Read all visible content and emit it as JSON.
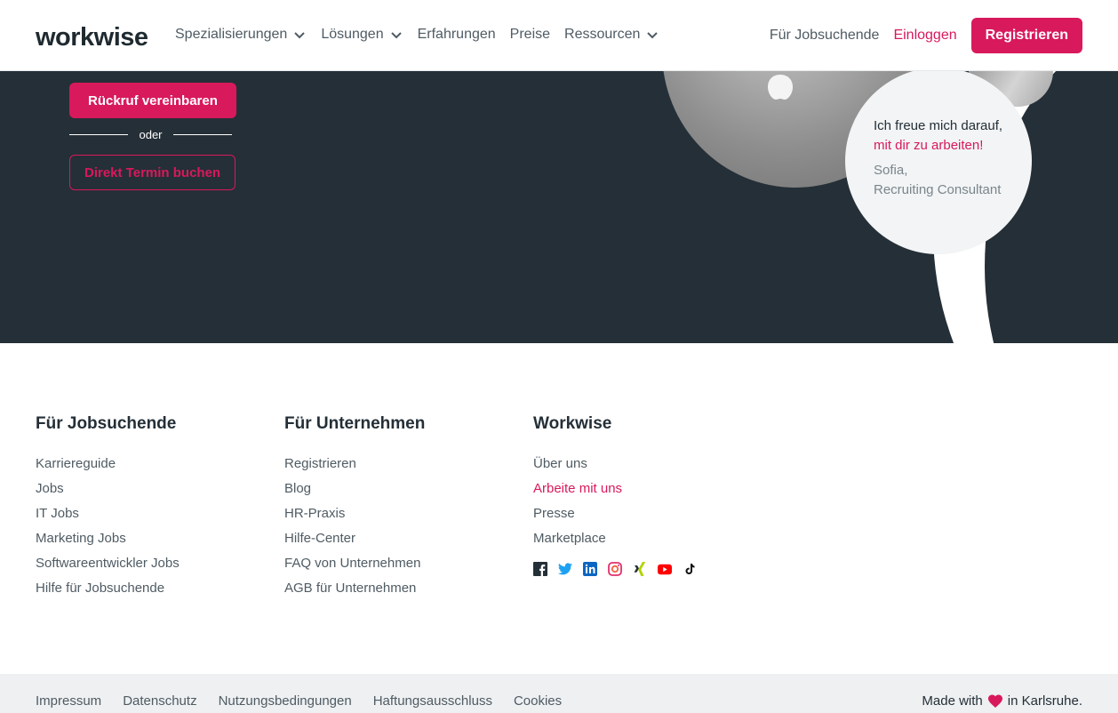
{
  "header": {
    "logo": "workwise",
    "nav": [
      {
        "label": "Spezialisierungen",
        "dropdown": true
      },
      {
        "label": "Lösungen",
        "dropdown": true
      },
      {
        "label": "Erfahrungen",
        "dropdown": false
      },
      {
        "label": "Preise",
        "dropdown": false
      },
      {
        "label": "Ressourcen",
        "dropdown": true
      }
    ],
    "for_jobseekers": "Für Jobsuchende",
    "login": "Einloggen",
    "register": "Registrieren"
  },
  "hero": {
    "callback_button": "Rückruf vereinbaren",
    "or_text": "oder",
    "appointment_button": "Direkt Termin buchen",
    "quote_line1": "Ich freue mich darauf,",
    "quote_line2": "mit dir zu arbeiten!",
    "quote_name": "Sofia,",
    "quote_role": "Recruiting Consultant"
  },
  "footer": {
    "columns": [
      {
        "title": "Für Jobsuchende",
        "links": [
          "Karriereguide",
          "Jobs",
          "IT Jobs",
          "Marketing Jobs",
          "Softwareentwickler Jobs",
          "Hilfe für Jobsuchende"
        ]
      },
      {
        "title": "Für Unternehmen",
        "links": [
          "Registrieren",
          "Blog",
          "HR-Praxis",
          "Hilfe-Center",
          "FAQ von Unternehmen",
          "AGB für Unternehmen"
        ]
      },
      {
        "title": "Workwise",
        "links": [
          "Über uns",
          "Arbeite mit uns",
          "Presse",
          "Marketplace"
        ]
      }
    ],
    "socials": [
      "facebook-icon",
      "twitter-icon",
      "linkedin-icon",
      "instagram-icon",
      "xing-icon",
      "youtube-icon",
      "tiktok-icon"
    ]
  },
  "bottom": {
    "links": [
      "Impressum",
      "Datenschutz",
      "Nutzungsbedingungen",
      "Haftungsausschluss",
      "Cookies"
    ],
    "made_with": "Made with",
    "in_city": "in Karlsruhe."
  },
  "colors": {
    "brand": "#d8195c",
    "dark": "#252f37",
    "text": "#4f5b63"
  }
}
